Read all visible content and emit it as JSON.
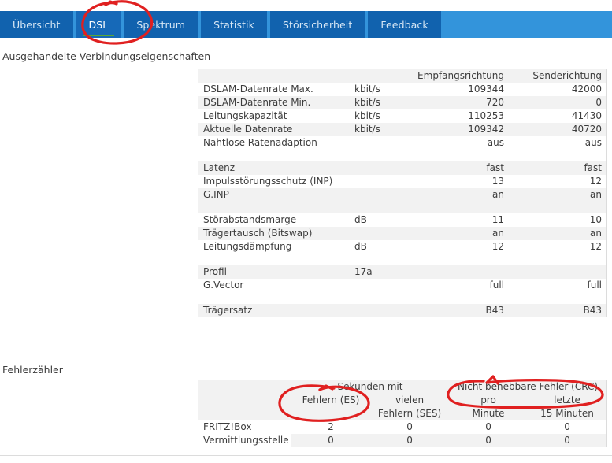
{
  "tabs": [
    {
      "label": "Übersicht",
      "active": false
    },
    {
      "label": "DSL",
      "active": true
    },
    {
      "label": "Spektrum",
      "active": false
    },
    {
      "label": "Statistik",
      "active": false
    },
    {
      "label": "Störsicherheit",
      "active": false
    },
    {
      "label": "Feedback",
      "active": false
    }
  ],
  "sections": {
    "negotiated_title": "Ausgehandelte Verbindungseigenschaften",
    "errors_title": "Fehlerzähler"
  },
  "negotiated_table": {
    "headers": {
      "label": "",
      "unit": "",
      "rx": "Empfangsrichtung",
      "tx": "Senderichtung"
    },
    "rows": [
      {
        "type": "data",
        "label": "DSLAM-Datenrate Max.",
        "unit": "kbit/s",
        "rx": "109344",
        "tx": "42000"
      },
      {
        "type": "data",
        "label": "DSLAM-Datenrate Min.",
        "unit": "kbit/s",
        "rx": "720",
        "tx": "0"
      },
      {
        "type": "data",
        "label": "Leitungskapazität",
        "unit": "kbit/s",
        "rx": "110253",
        "tx": "41430"
      },
      {
        "type": "data",
        "label": "Aktuelle Datenrate",
        "unit": "kbit/s",
        "rx": "109342",
        "tx": "40720"
      },
      {
        "type": "data",
        "label": "Nahtlose Ratenadaption",
        "unit": "",
        "rx": "aus",
        "tx": "aus"
      },
      {
        "type": "spacer"
      },
      {
        "type": "data",
        "label": "Latenz",
        "unit": "",
        "rx": "fast",
        "tx": "fast"
      },
      {
        "type": "data",
        "label": "Impulsstörungsschutz (INP)",
        "unit": "",
        "rx": "13",
        "tx": "12"
      },
      {
        "type": "data",
        "label": "G.INP",
        "unit": "",
        "rx": "an",
        "tx": "an"
      },
      {
        "type": "spacer"
      },
      {
        "type": "data",
        "label": "Störabstandsmarge",
        "unit": "dB",
        "rx": "11",
        "tx": "10"
      },
      {
        "type": "data",
        "label": "Trägertausch (Bitswap)",
        "unit": "",
        "rx": "an",
        "tx": "an"
      },
      {
        "type": "data",
        "label": "Leitungsdämpfung",
        "unit": "dB",
        "rx": "12",
        "tx": "12"
      },
      {
        "type": "spacer"
      },
      {
        "type": "data",
        "label": "Profil",
        "unit": "17a",
        "rx": "",
        "tx": ""
      },
      {
        "type": "data",
        "label": "G.Vector",
        "unit": "",
        "rx": "full",
        "tx": "full"
      },
      {
        "type": "spacer"
      },
      {
        "type": "data",
        "label": "Trägersatz",
        "unit": "",
        "rx": "B43",
        "tx": "B43"
      }
    ]
  },
  "error_table": {
    "group_headers": {
      "seconds_with": "Sekunden mit",
      "uncorrectable": "Nicht behebbare Fehler (CRC)"
    },
    "sub_headers": {
      "es_line1": "Fehlern (ES)",
      "ses_line1": "vielen",
      "ses_line2": "Fehlern (SES)",
      "crc_min_line1": "pro",
      "crc_min_line2": "Minute",
      "crc_15_line1": "letzte",
      "crc_15_line2": "15 Minuten"
    },
    "rows": [
      {
        "name": "FRITZ!Box",
        "es": "2",
        "ses": "0",
        "crc_min": "0",
        "crc_15": "0"
      },
      {
        "name": "Vermittlungsstelle",
        "es": "0",
        "ses": "0",
        "crc_min": "0",
        "crc_15": "0"
      }
    ]
  },
  "annotations": {
    "color": "#e02020",
    "marks": [
      {
        "name": "circle-dsl-tab",
        "target": "DSL"
      },
      {
        "name": "circle-fehlern-es",
        "target": "Fehlern (ES)"
      },
      {
        "name": "circle-crc-header",
        "target": "Nicht behebbare Fehler (CRC)"
      }
    ]
  },
  "colors": {
    "tab_bar_bg": "#3394db",
    "tab_bg": "#1162ae",
    "tab_active_bg": "#1669b8",
    "tab_active_underline": "#5aa832",
    "row_shade": "#f2f2f2",
    "text": "#3c3c3c",
    "annotation_red": "#e02020"
  }
}
